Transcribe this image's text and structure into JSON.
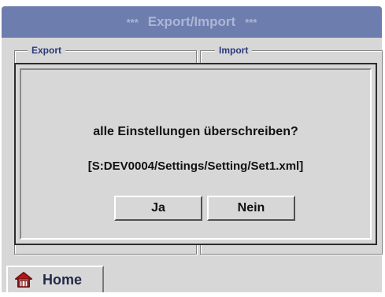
{
  "window": {
    "title_stars_left": "***",
    "title": "Export/Import",
    "title_stars_right": "***"
  },
  "groups": {
    "export_label": "Export",
    "import_label": "Import"
  },
  "footer": {
    "home_label": "Home",
    "home_icon": "home-icon"
  },
  "dialog": {
    "message": "alle Einstellungen überschreiben?",
    "path": "[S:DEV0004/Settings/Setting/Set1.xml]",
    "yes_label": "Ja",
    "no_label": "Nein"
  },
  "colors": {
    "title_bar": "#6d7dae",
    "panel": "#d7d7d7",
    "label_text": "#2a3a7a"
  }
}
